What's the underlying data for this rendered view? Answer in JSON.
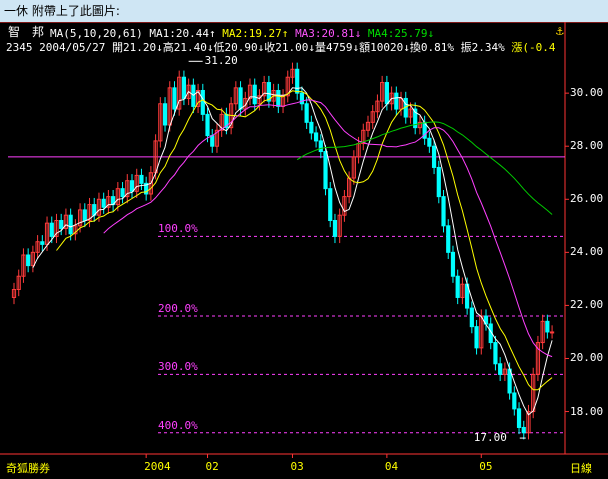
{
  "window": {
    "title": "一休 附帶上了此圖片:"
  },
  "stock": {
    "name": "智　邦"
  },
  "ma_header": {
    "ma_params": "MA(5,10,20,61)",
    "ma1": "MA1:20.44↑",
    "ma2": "MA2:19.27↑",
    "ma3": "MA3:20.81↓",
    "ma4": "MA4:25.79↓"
  },
  "quote": {
    "code_date": "2345 2004/05/27",
    "open": "開21.20↓",
    "high": "高21.40↓",
    "low": "低20.90↓",
    "close": "收21.00↓",
    "volume": "量4759↓",
    "amount": "額10020↓",
    "turnover": "換0.81%",
    "amplitude": "振2.34%",
    "change": "漲(-0.4"
  },
  "icons": {
    "anchor": "anchor-icon"
  },
  "colors": {
    "background": "#000000",
    "up": "#ff3b3b",
    "down": "#00ffff",
    "ma1": "#ffffff",
    "ma2": "#ffff00",
    "ma3": "#ff40ff",
    "ma4": "#00cc00",
    "percent_line": "#ff40ff"
  },
  "annotations": {
    "peak_label": "31.20",
    "trough_label": "17.00"
  },
  "footer": {
    "broker": "奇狐勝券",
    "period": "日線"
  },
  "chart_data": {
    "type": "candlestick",
    "y_axis": {
      "min": 16.4,
      "max": 31.4,
      "ticks": [
        18,
        20,
        22,
        24,
        26,
        28,
        30
      ],
      "tick_labels": [
        "18.00",
        "20.00",
        "22.00",
        "24.00",
        "26.00",
        "28.00",
        "30.00"
      ]
    },
    "x_labels": [
      {
        "label": "2004",
        "idx": 28
      },
      {
        "label": "02",
        "idx": 41
      },
      {
        "label": "03",
        "idx": 59
      },
      {
        "label": "04",
        "idx": 79
      },
      {
        "label": "05",
        "idx": 99
      }
    ],
    "percent_levels": [
      {
        "label": "100.0%",
        "price": 24.6
      },
      {
        "label": "200.0%",
        "price": 21.6
      },
      {
        "label": "300.0%",
        "price": 19.4
      },
      {
        "label": "400.0%",
        "price": 17.2
      }
    ],
    "resistance_level": 27.6,
    "peak": {
      "price": 31.2,
      "idx": 37
    },
    "trough": {
      "price": 17.0,
      "idx": 108
    },
    "closes": [
      22.6,
      23.1,
      23.9,
      23.5,
      24.0,
      24.4,
      24.3,
      25.1,
      24.6,
      25.2,
      24.9,
      25.4,
      24.7,
      25.0,
      25.6,
      25.2,
      25.8,
      25.4,
      26.0,
      25.7,
      26.1,
      25.8,
      26.4,
      26.1,
      26.7,
      26.3,
      26.9,
      26.6,
      26.2,
      27.0,
      28.2,
      29.6,
      28.8,
      30.2,
      29.4,
      30.6,
      29.8,
      30.3,
      29.5,
      30.1,
      29.2,
      28.4,
      28.0,
      28.6,
      29.2,
      28.7,
      29.6,
      30.2,
      29.4,
      29.8,
      30.3,
      29.6,
      29.9,
      30.4,
      29.7,
      30.1,
      29.5,
      29.9,
      30.6,
      30.9,
      30.0,
      29.6,
      28.9,
      28.5,
      28.2,
      27.8,
      26.4,
      25.2,
      24.6,
      25.4,
      26.1,
      26.8,
      27.6,
      28.1,
      28.6,
      28.9,
      29.3,
      29.7,
      30.4,
      29.6,
      30.0,
      29.4,
      29.8,
      29.1,
      29.4,
      28.7,
      28.9,
      28.3,
      28.0,
      27.2,
      26.1,
      25.0,
      24.0,
      23.1,
      22.3,
      22.8,
      21.9,
      21.2,
      20.4,
      21.6,
      21.3,
      20.6,
      19.8,
      19.4,
      19.6,
      18.7,
      18.1,
      17.4,
      17.2,
      18.0,
      19.4,
      20.6,
      21.4,
      21.0,
      21.0
    ]
  }
}
